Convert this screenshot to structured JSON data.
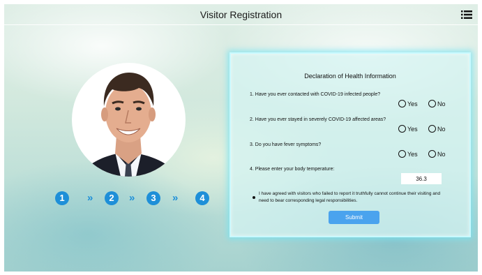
{
  "header": {
    "title": "Visitor Registration",
    "menu_icon": "list-menu-icon"
  },
  "avatar": {
    "icon": "visitor-photo"
  },
  "steps": {
    "numbers": [
      "1",
      "2",
      "3",
      "4"
    ],
    "separator": "»",
    "color": "#1e8fd8"
  },
  "form": {
    "title": "Declaration of Health Information",
    "questions": [
      {
        "text": "1. Have you ever contacted with COVID-19 infected people?",
        "yes": "Yes",
        "no": "No"
      },
      {
        "text": "2. Have you ever stayed in severely COVID-19 affected areas?",
        "yes": "Yes",
        "no": "No"
      },
      {
        "text": "3. Do you have fever symptoms?",
        "yes": "Yes",
        "no": "No"
      }
    ],
    "temperature_label": "4. Please enter your body temperature:",
    "temperature_value": "36.3",
    "agreement": "I have agreed with visitors who failed to report it truthfully cannot continue their visiting and need to bear corresponding legal responsibilities.",
    "submit_label": "Submit",
    "submit_color": "#4aa3ee"
  }
}
